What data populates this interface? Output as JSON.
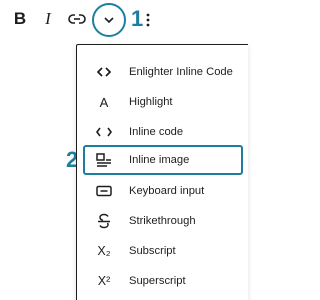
{
  "toolbar": {
    "bold_label": "B",
    "italic_label": "I",
    "link_icon": "link-icon",
    "more_icon": "chevron-down-icon",
    "kebab_icon": "more-vertical-icon"
  },
  "callouts": {
    "one": "1",
    "two": "2",
    "accent_color": "#1c7fa0"
  },
  "menu": {
    "items": [
      {
        "label": "Enlighter Inline Code",
        "icon": "code-brackets-icon",
        "glyph": "<>"
      },
      {
        "label": "Highlight",
        "icon": "highlight-a-icon",
        "glyph": "A"
      },
      {
        "label": "Inline code",
        "icon": "inline-code-icon",
        "glyph": "< >"
      },
      {
        "label": "Inline image",
        "icon": "inline-image-icon",
        "glyph": ""
      },
      {
        "label": "Keyboard input",
        "icon": "keyboard-icon",
        "glyph": ""
      },
      {
        "label": "Strikethrough",
        "icon": "strikethrough-icon",
        "glyph": ""
      },
      {
        "label": "Subscript",
        "icon": "subscript-icon",
        "glyph": "X₂"
      },
      {
        "label": "Superscript",
        "icon": "superscript-icon",
        "glyph": "X²"
      }
    ],
    "selected_label": "Inline image"
  }
}
